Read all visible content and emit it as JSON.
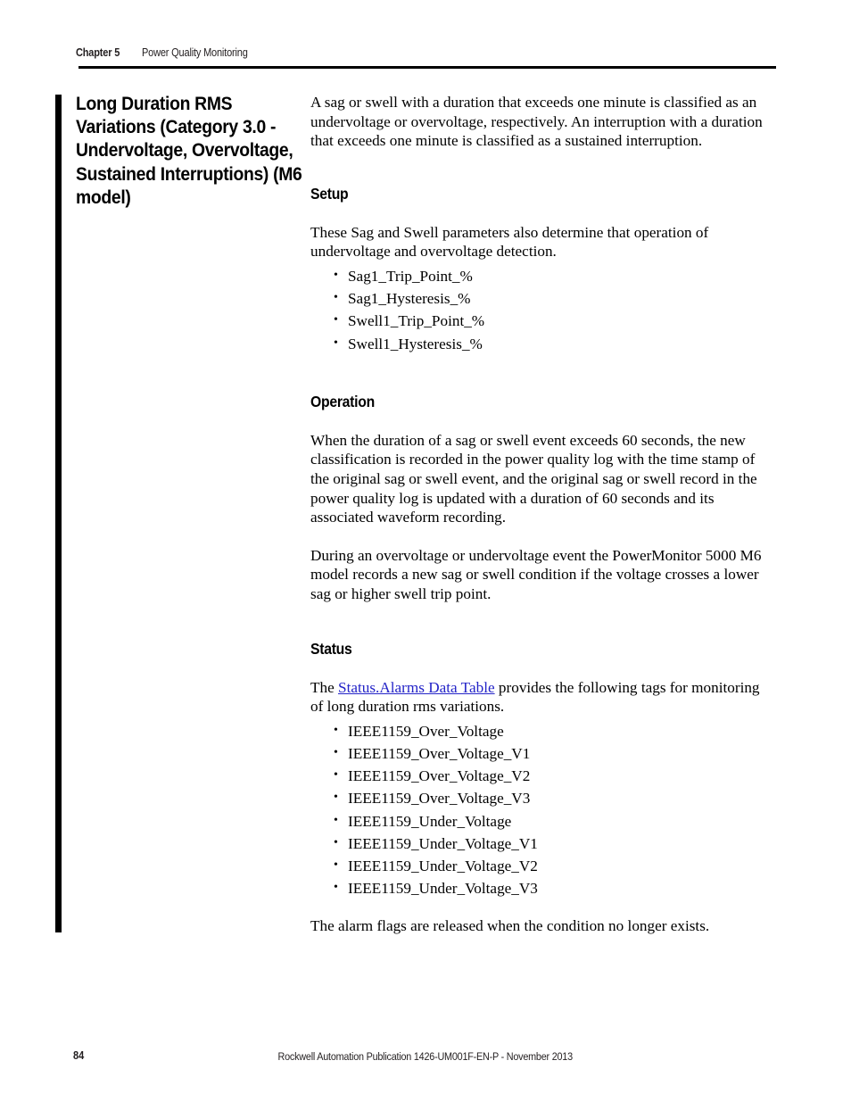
{
  "header": {
    "chapter_label": "Chapter 5",
    "section_label": "Power Quality Monitoring"
  },
  "section_heading": {
    "lines": [
      "Long Duration RMS",
      "Variations (Category 3.0 -",
      "Undervoltage, Overvoltage,",
      "Sustained Interruptions) (M6",
      "model)"
    ]
  },
  "body": {
    "intro_paragraph": "A sag or swell with a duration that exceeds one minute is classified as an undervoltage or overvoltage, respectively. An interruption with a duration that exceeds one minute is classified as a sustained interruption.",
    "setup": {
      "heading": "Setup",
      "paragraph": "These Sag and Swell parameters also determine that operation of undervoltage and overvoltage detection.",
      "items": [
        "Sag1_Trip_Point_%",
        "Sag1_Hysteresis_%",
        "Swell1_Trip_Point_%",
        "Swell1_Hysteresis_%"
      ]
    },
    "operation": {
      "heading": "Operation",
      "paragraph_1": "When the duration of a sag or swell event exceeds 60 seconds, the new classification is recorded in the power quality log with the time stamp of the original sag or swell event, and the original sag or swell record in the power quality log is updated with a duration of 60 seconds and its associated waveform recording.",
      "paragraph_2": "During an overvoltage or undervoltage event the PowerMonitor 5000 M6 model records a new sag or swell condition if the voltage crosses a lower sag or higher swell trip point."
    },
    "status": {
      "heading": "Status",
      "intro_prefix": "The ",
      "link_text": "Status.Alarms Data Table",
      "intro_suffix": " provides the following tags for monitoring of long duration rms variations.",
      "items": [
        "IEEE1159_Over_Voltage",
        "IEEE1159_Over_Voltage_V1",
        "IEEE1159_Over_Voltage_V2",
        "IEEE1159_Over_Voltage_V3",
        "IEEE1159_Under_Voltage",
        "IEEE1159_Under_Voltage_V1",
        "IEEE1159_Under_Voltage_V2",
        "IEEE1159_Under_Voltage_V3"
      ],
      "closing_paragraph": "The alarm flags are released when the condition no longer exists."
    }
  },
  "footer": {
    "page_number": "84",
    "publication": "Rockwell Automation Publication 1426-UM001F-EN-P - November 2013"
  },
  "colors": {
    "link": "#2424c8",
    "text": "#000000",
    "rule": "#000000"
  }
}
